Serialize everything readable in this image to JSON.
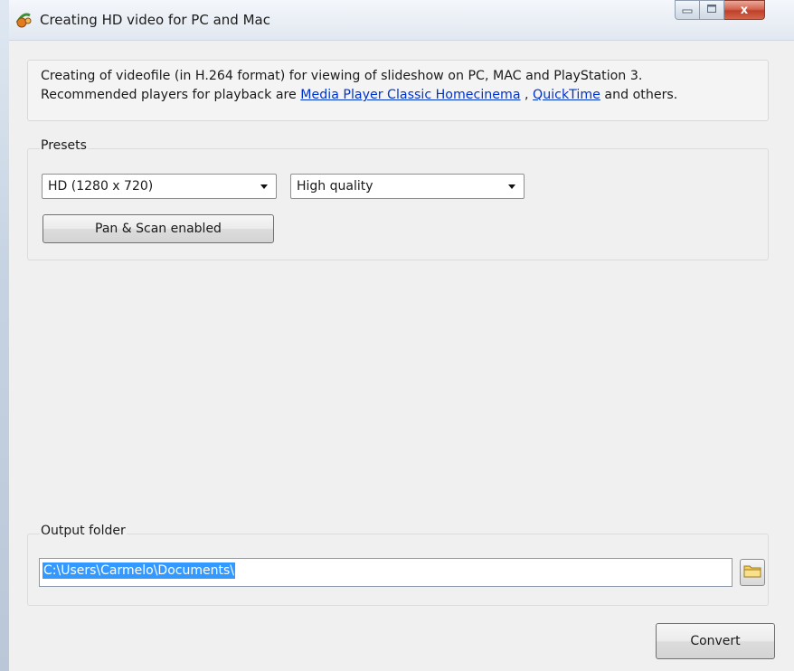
{
  "window": {
    "title": "Creating HD video for PC and Mac",
    "close_glyph": "x"
  },
  "info": {
    "line1": "Creating of videofile (in H.264 format) for viewing of slideshow on PC, MAC and PlayStation 3.",
    "line2_prefix": "Recommended players for playback are ",
    "link1": "Media Player Classic Homecinema",
    "separator": " , ",
    "link2": "QuickTime",
    "line2_suffix": " and others."
  },
  "presets": {
    "label": "Presets",
    "resolution_value": "HD (1280 x 720)",
    "quality_value": "High quality",
    "pan_scan_label": "Pan & Scan enabled"
  },
  "output": {
    "label": "Output folder",
    "path_value": "C:\\Users\\Carmelo\\Documents\\"
  },
  "actions": {
    "convert_label": "Convert"
  },
  "icons": {
    "app": "app-icon",
    "minimize": "minimize-icon",
    "maximize": "maximize-icon",
    "close": "close-icon",
    "folder": "folder-icon",
    "dropdown": "chevron-down-icon"
  },
  "colors": {
    "link": "#0033cc",
    "selection": "#3399ff",
    "close_button": "#c9452f"
  }
}
